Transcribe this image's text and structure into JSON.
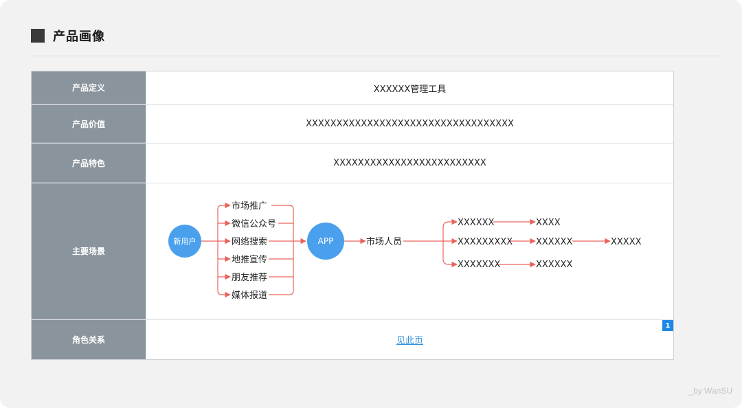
{
  "header": {
    "title": "产品画像"
  },
  "rows": {
    "definition": {
      "label": "产品定义",
      "value": "XXXXXX管理工具"
    },
    "value": {
      "label": "产品价值",
      "value": "XXXXXXXXXXXXXXXXXXXXXXXXXXXXXXXXXX"
    },
    "features": {
      "label": "产品特色",
      "value": "XXXXXXXXXXXXXXXXXXXXXXXXX"
    },
    "scenario": {
      "label": "主要场景"
    },
    "roles": {
      "label": "角色关系",
      "link": "见此页",
      "badge": "1"
    }
  },
  "diagram": {
    "source_node": "新用户",
    "channels": [
      "市场推广",
      "微信公众号",
      "网络搜索",
      "地推宣传",
      "朋友推荐",
      "媒体报道"
    ],
    "app_node": "APP",
    "market_node": "市场人员",
    "branches": [
      [
        "XXXXXX",
        "XXXX"
      ],
      [
        "XXXXXXXXX",
        "XXXXXX",
        "XXXXX"
      ],
      [
        "XXXXXXX",
        "XXXXXX"
      ]
    ]
  },
  "colors": {
    "arrow": "#e9635b",
    "node": "#4aa0ec",
    "label_bg": "#8a949d"
  },
  "watermark": "_by WanSU"
}
